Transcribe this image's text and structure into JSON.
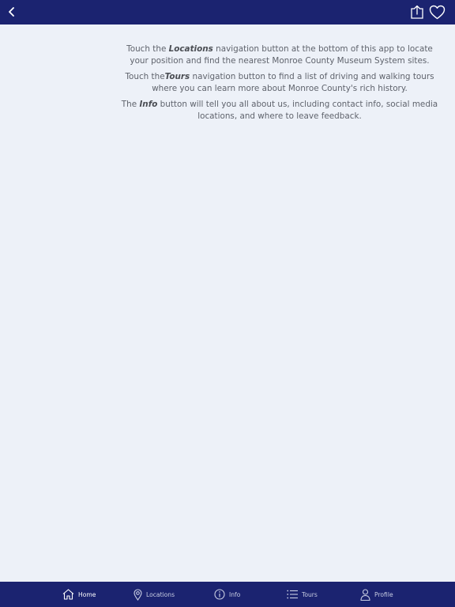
{
  "header": {
    "back_icon": "chevron-left-icon",
    "share_icon": "share-icon",
    "favorite_icon": "heart-icon"
  },
  "content": {
    "p1": {
      "before": "Touch the ",
      "bold": "Locations",
      "after": " navigation button at the bottom of this app to locate your position and find the nearest Monroe County Museum System sites."
    },
    "p2": {
      "before": "Touch the",
      "bold": "Tours",
      "after": " navigation button to find a list of driving and walking tours where you can learn more about Monroe County's rich history."
    },
    "p3": {
      "before": "The ",
      "bold": "Info",
      "after": " button will tell you all about us, including contact info, social media locations, and where to leave feedback."
    }
  },
  "tabbar": {
    "tabs": [
      {
        "label": "Home",
        "icon": "home-icon",
        "active": true
      },
      {
        "label": "Locations",
        "icon": "map-pin-icon",
        "active": false
      },
      {
        "label": "Info",
        "icon": "info-icon",
        "active": false
      },
      {
        "label": "Tours",
        "icon": "list-icon",
        "active": false
      },
      {
        "label": "Profile",
        "icon": "person-icon",
        "active": false
      }
    ]
  },
  "colors": {
    "bar_background": "#1b2370",
    "page_background": "#edf1f8",
    "text": "#5f636c"
  }
}
